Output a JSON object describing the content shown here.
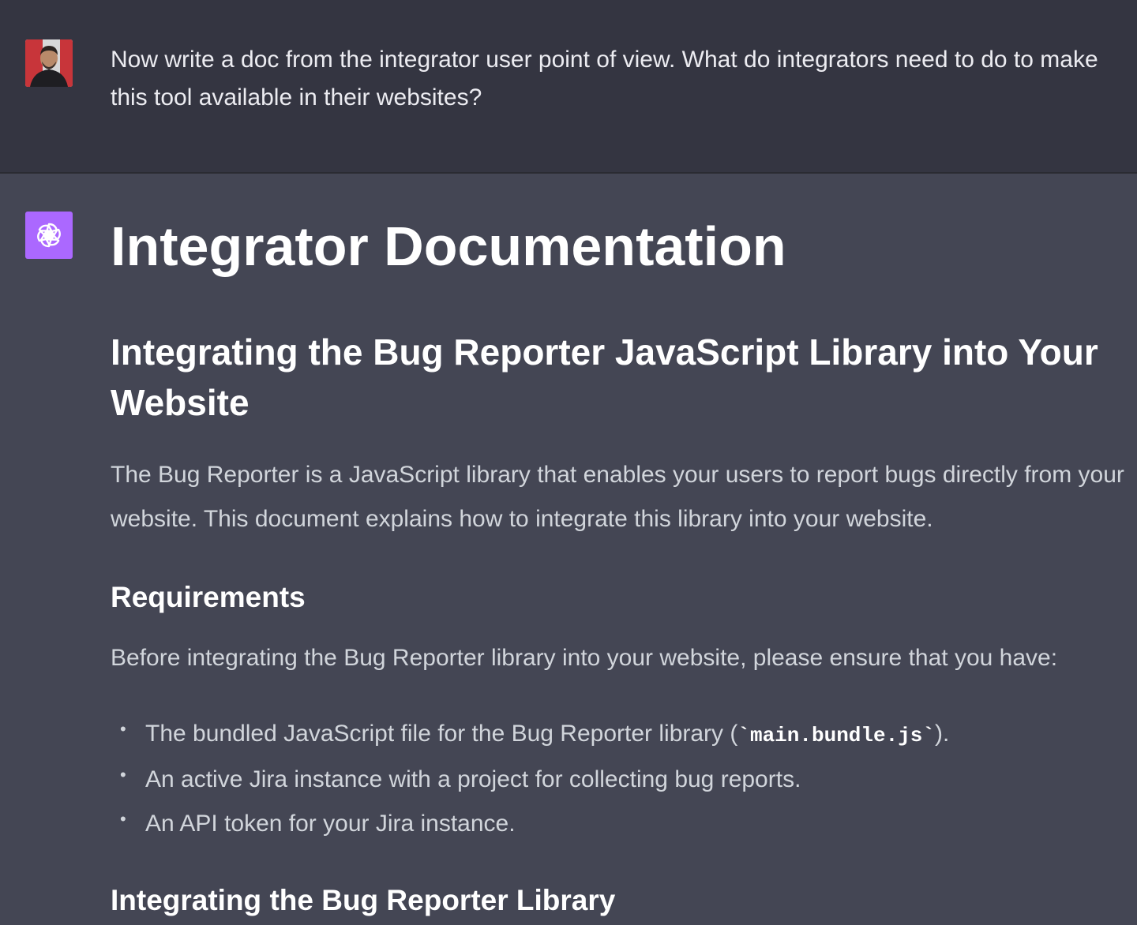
{
  "user_turn": {
    "avatar_icon": "user-avatar-photo",
    "message": "Now write a doc from the integrator user point of view. What do integrators need to do to make this tool available in their websites?"
  },
  "assistant_turn": {
    "avatar_icon": "openai-logo-icon",
    "avatar_color": "#ab68ff",
    "title": "Integrator Documentation",
    "subtitle": "Integrating the Bug Reporter JavaScript Library into Your Website",
    "intro": "The Bug Reporter is a JavaScript library that enables your users to report bugs directly from your website. This document explains how to integrate this library into your website.",
    "requirements": {
      "heading": "Requirements",
      "intro": "Before integrating the Bug Reporter library into your website, please ensure that you have:",
      "items": [
        {
          "before": "The bundled JavaScript file for the Bug Reporter library (",
          "code": "`main.bundle.js`",
          "after": ")."
        },
        {
          "text": "An active Jira instance with a project for collecting bug reports."
        },
        {
          "text": "An API token for your Jira instance."
        }
      ]
    },
    "next_heading": "Integrating the Bug Reporter Library"
  },
  "colors": {
    "user_bg": "#343541",
    "assistant_bg": "#444654",
    "heading_text": "#ffffff",
    "body_text": "#d1d5db"
  }
}
